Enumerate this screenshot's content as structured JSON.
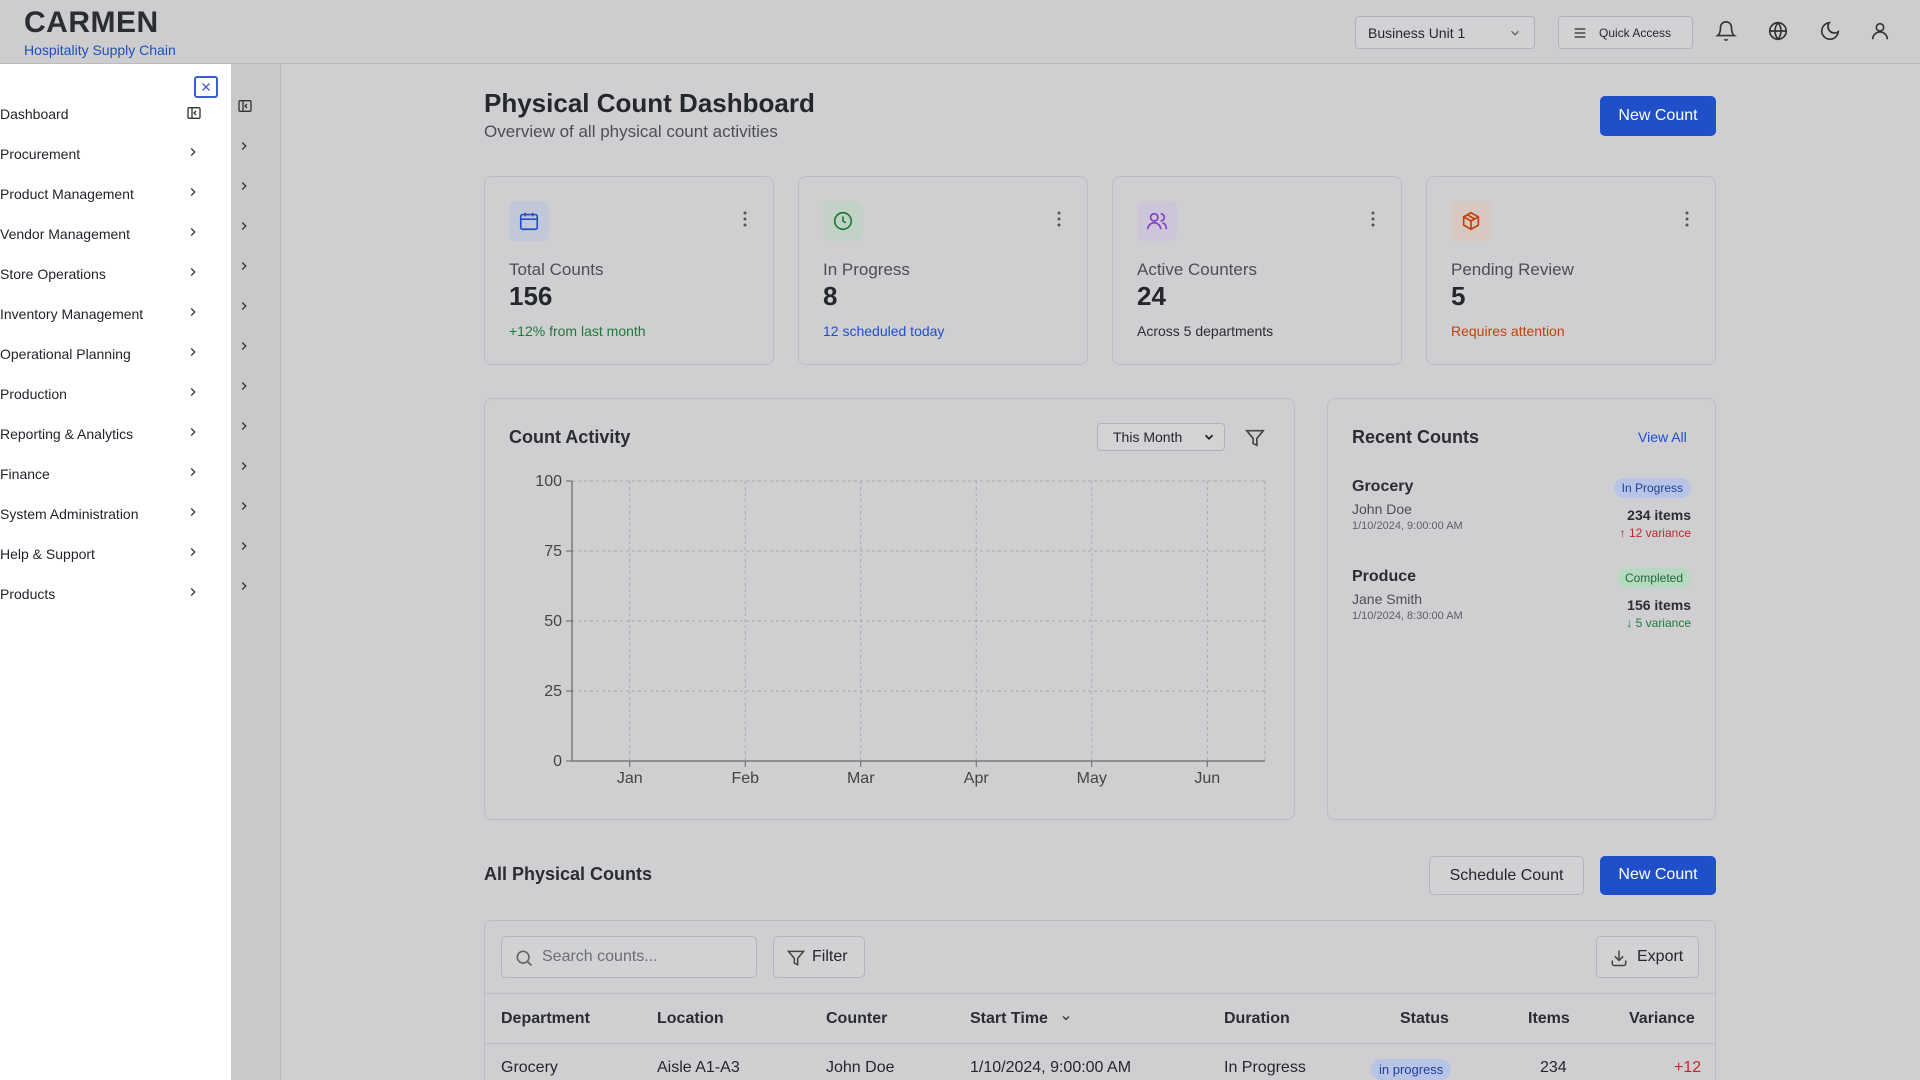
{
  "header": {
    "brand": "CARMEN",
    "brand_sub": "Hospitality Supply Chain",
    "business_unit": "Business Unit 1",
    "quick_access": "Quick Access"
  },
  "sidebar": {
    "items": [
      {
        "label": "Dashboard"
      },
      {
        "label": "Procurement"
      },
      {
        "label": "Product Management"
      },
      {
        "label": "Vendor Management"
      },
      {
        "label": "Store Operations"
      },
      {
        "label": "Inventory Management"
      },
      {
        "label": "Operational Planning"
      },
      {
        "label": "Production"
      },
      {
        "label": "Reporting & Analytics"
      },
      {
        "label": "Finance"
      },
      {
        "label": "System Administration"
      },
      {
        "label": "Help & Support"
      },
      {
        "label": "Products"
      }
    ]
  },
  "page": {
    "title": "Physical Count Dashboard",
    "subtitle": "Overview of all physical count activities",
    "new_count": "New Count"
  },
  "stats": [
    {
      "label": "Total Counts",
      "value": "156",
      "note": "+12% from last month",
      "note_color": "#1e7a3a",
      "icon": "calendar-icon",
      "icon_color": "#1f4fc9",
      "icon_bg": "#c2c8d8"
    },
    {
      "label": "In Progress",
      "value": "8",
      "note": "12 scheduled today",
      "note_color": "#1f4fc9",
      "icon": "clock-icon",
      "icon_color": "#1e7a3a",
      "icon_bg": "#c2d2c6"
    },
    {
      "label": "Active Counters",
      "value": "24",
      "note": "Across 5 departments",
      "note_color": "#2a2d32",
      "icon": "users-icon",
      "icon_color": "#7e3fc4",
      "icon_bg": "#cdc5d8"
    },
    {
      "label": "Pending Review",
      "value": "5",
      "note": "Requires attention",
      "note_color": "#c2410c",
      "icon": "package-icon",
      "icon_color": "#c2410c",
      "icon_bg": "#d8c9c0"
    }
  ],
  "activity": {
    "title": "Count Activity",
    "period": "This Month"
  },
  "chart_data": {
    "type": "line",
    "title": "Count Activity",
    "categories": [
      "Jan",
      "Feb",
      "Mar",
      "Apr",
      "May",
      "Jun"
    ],
    "yticks": [
      "0",
      "25",
      "50",
      "75",
      "100"
    ],
    "ylim": [
      0,
      100
    ],
    "series": [],
    "grid": true
  },
  "recent": {
    "title": "Recent Counts",
    "view_all": "View All",
    "items": [
      {
        "dept": "Grocery",
        "counter": "John Doe",
        "time": "1/10/2024, 9:00:00 AM",
        "status": "In Progress",
        "items": "234 items",
        "variance": "↑ 12 variance",
        "variance_color": "#c0262d"
      },
      {
        "dept": "Produce",
        "counter": "Jane Smith",
        "time": "1/10/2024, 8:30:00 AM",
        "status": "Completed",
        "items": "156 items",
        "variance": "↓ 5 variance",
        "variance_color": "#1e7a3a"
      }
    ]
  },
  "all_counts": {
    "title": "All Physical Counts",
    "schedule": "Schedule Count",
    "new_count": "New Count",
    "search_placeholder": "Search counts...",
    "filter": "Filter",
    "export": "Export",
    "columns": [
      "Department",
      "Location",
      "Counter",
      "Start Time",
      "Duration",
      "Status",
      "Items",
      "Variance"
    ],
    "rows": [
      {
        "department": "Grocery",
        "location": "Aisle A1-A3",
        "counter": "John Doe",
        "start_time": "1/10/2024, 9:00:00 AM",
        "duration": "In Progress",
        "status": "in progress",
        "items": "234",
        "variance": "+12"
      }
    ]
  }
}
